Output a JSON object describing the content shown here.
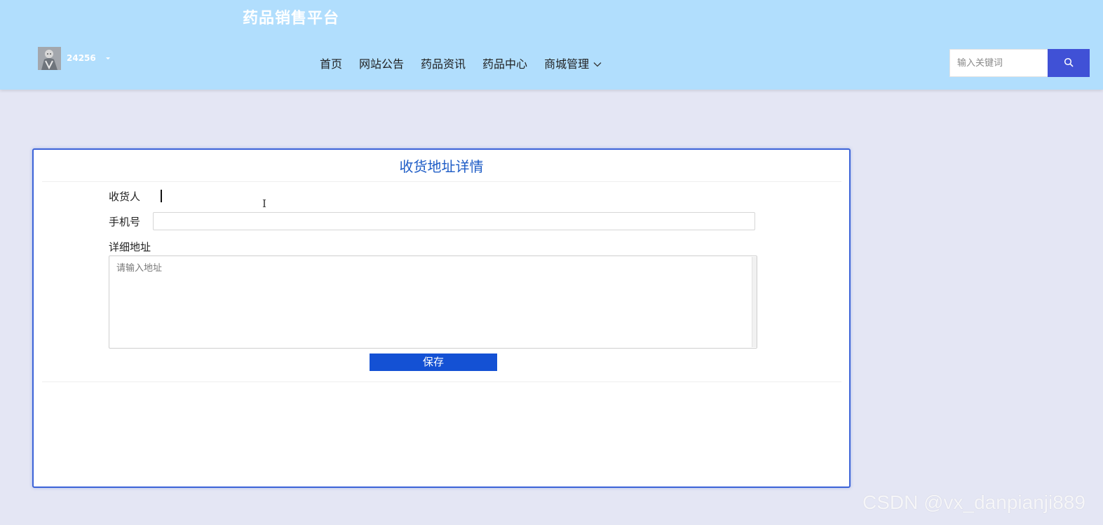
{
  "header": {
    "site_title": "药品销售平台",
    "username": "24256",
    "nav": [
      {
        "label": "首页"
      },
      {
        "label": "网站公告"
      },
      {
        "label": "药品资讯"
      },
      {
        "label": "药品中心"
      },
      {
        "label": "商城管理",
        "has_dropdown": true
      }
    ],
    "search": {
      "placeholder": "输入关键词",
      "value": "",
      "icon": "search-icon"
    }
  },
  "form": {
    "title": "收货地址详情",
    "receiver_label": "收货人",
    "receiver_value": "",
    "phone_label": "手机号",
    "phone_value": "",
    "address_label": "详细地址",
    "address_placeholder": "请输入地址",
    "address_value": "",
    "save_label": "保存"
  },
  "watermark": "CSDN @vx_danpianji889",
  "colors": {
    "header_bg": "#b1defd",
    "page_bg": "#e4e6f4",
    "card_border": "#3c63d8",
    "title_blue": "#1e5cc6",
    "save_button": "#1451d4",
    "search_button": "#4051d6"
  }
}
